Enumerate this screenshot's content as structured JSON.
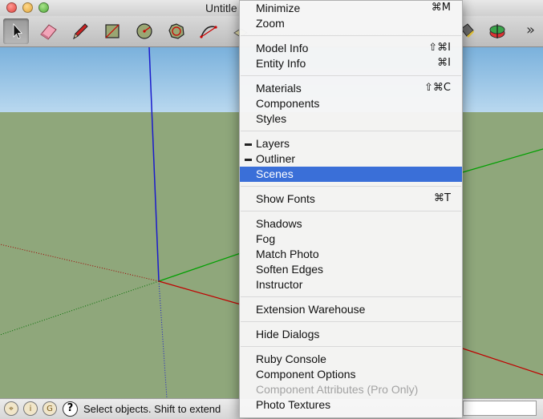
{
  "window": {
    "title": "Untitle"
  },
  "toolbar": {
    "tools": [
      {
        "name": "select-tool",
        "icon": "arrow-icon",
        "selected": true
      },
      {
        "name": "eraser-tool",
        "icon": "eraser-icon"
      },
      {
        "name": "pencil-tool",
        "icon": "pencil-icon"
      },
      {
        "name": "rectangle-tool",
        "icon": "rectangle-icon"
      },
      {
        "name": "circle-tool",
        "icon": "circle-icon"
      },
      {
        "name": "polygon-tool",
        "icon": "polygon-icon"
      },
      {
        "name": "arc-tool",
        "icon": "arc-icon"
      }
    ],
    "more": "»"
  },
  "menu": {
    "groups": [
      [
        {
          "label": "Minimize",
          "shortcut": "⌘M"
        },
        {
          "label": "Zoom",
          "shortcut": ""
        }
      ],
      [
        {
          "label": "Model Info",
          "shortcut": "⇧⌘I"
        },
        {
          "label": "Entity Info",
          "shortcut": "⌘I"
        }
      ],
      [
        {
          "label": "Materials",
          "shortcut": "⇧⌘C"
        },
        {
          "label": "Components",
          "shortcut": ""
        },
        {
          "label": "Styles",
          "shortcut": ""
        }
      ],
      [
        {
          "label": "Layers",
          "shortcut": "",
          "checked": true
        },
        {
          "label": "Outliner",
          "shortcut": "",
          "checked": true
        },
        {
          "label": "Scenes",
          "shortcut": "",
          "highlighted": true
        }
      ],
      [
        {
          "label": "Show Fonts",
          "shortcut": "⌘T"
        }
      ],
      [
        {
          "label": "Shadows",
          "shortcut": ""
        },
        {
          "label": "Fog",
          "shortcut": ""
        },
        {
          "label": "Match Photo",
          "shortcut": ""
        },
        {
          "label": "Soften Edges",
          "shortcut": ""
        },
        {
          "label": "Instructor",
          "shortcut": ""
        }
      ],
      [
        {
          "label": "Extension Warehouse",
          "shortcut": ""
        }
      ],
      [
        {
          "label": "Hide Dialogs",
          "shortcut": ""
        }
      ],
      [
        {
          "label": "Ruby Console",
          "shortcut": ""
        },
        {
          "label": "Component Options",
          "shortcut": ""
        },
        {
          "label": "Component Attributes (Pro Only)",
          "shortcut": "",
          "disabled": true
        },
        {
          "label": "Photo Textures",
          "shortcut": ""
        }
      ]
    ]
  },
  "status": {
    "text": "Select objects. Shift to extend",
    "help_glyph": "?"
  },
  "colors": {
    "sky": "#8fbfe6",
    "ground": "#8fa77b",
    "highlight": "#3a6fd8",
    "x_axis": "#c00000",
    "y_axis": "#00a000",
    "z_axis": "#0000c8"
  }
}
